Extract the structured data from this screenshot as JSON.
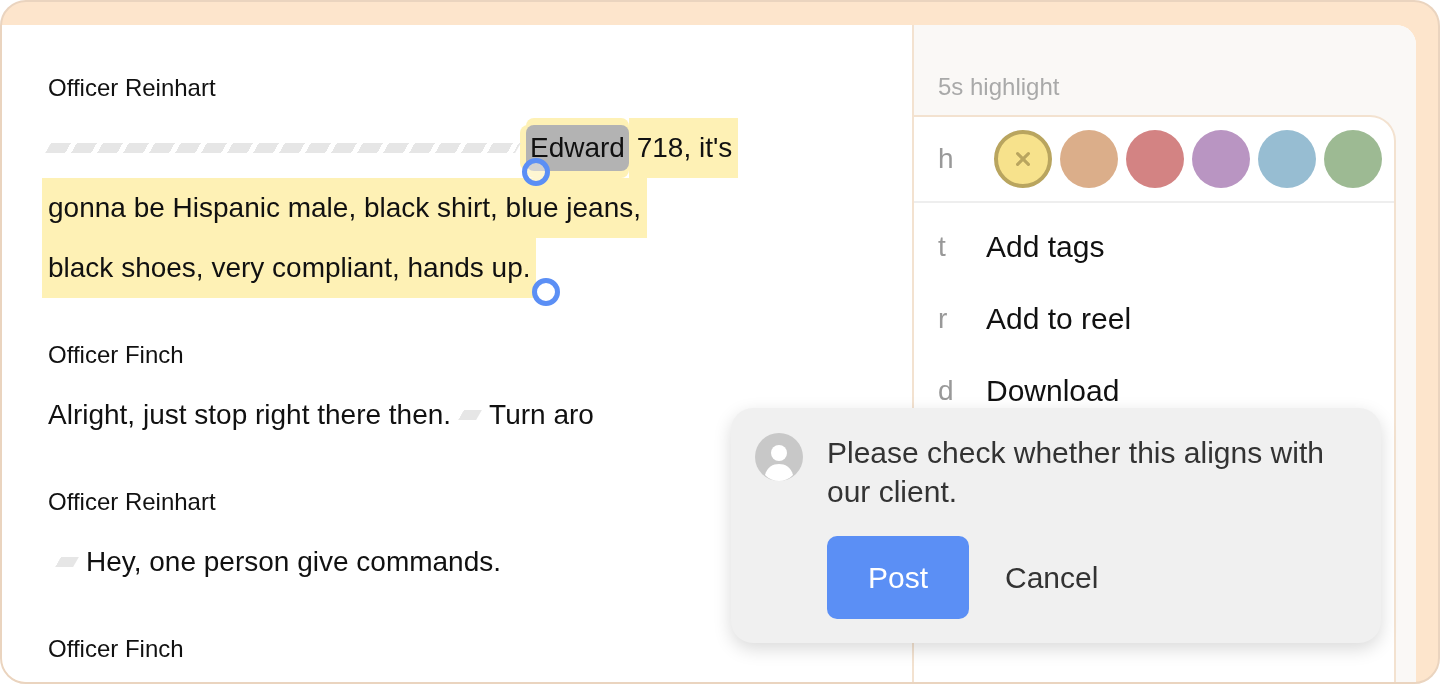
{
  "transcript": [
    {
      "speaker": "Officer Reinhart",
      "lines": [
        [
          {
            "kind": "longredaction"
          },
          {
            "kind": "handle"
          },
          {
            "kind": "text",
            "text": "Edward",
            "highlighted": true,
            "selected": true
          },
          {
            "kind": "text",
            "text": " 718, it's",
            "highlighted": true,
            "selected": false
          }
        ],
        [
          {
            "kind": "text",
            "text": "gonna be Hispanic male, black shirt, blue jeans,",
            "highlighted": true,
            "selected": false
          }
        ],
        [
          {
            "kind": "text",
            "text": "black shoes, very compliant, hands up.",
            "highlighted": true,
            "selected": false
          },
          {
            "kind": "handle"
          }
        ]
      ]
    },
    {
      "speaker": "Officer Finch",
      "lines": [
        [
          {
            "kind": "text",
            "text": "Alright, just stop right there then.",
            "highlighted": false,
            "selected": false
          },
          {
            "kind": "redaction"
          },
          {
            "kind": "text",
            "text": "Turn aro",
            "highlighted": false,
            "selected": false
          }
        ]
      ]
    },
    {
      "speaker": "Officer Reinhart",
      "lines": [
        [
          {
            "kind": "redaction"
          },
          {
            "kind": "text",
            "text": "Hey, one person give commands.",
            "highlighted": false,
            "selected": false
          }
        ]
      ]
    },
    {
      "speaker": "Officer Finch"
    }
  ],
  "panel": {
    "label": "5s highlight",
    "color_row": {
      "key": "h",
      "colors": [
        {
          "color": "#f7e28c",
          "selected": true
        },
        {
          "color": "#dbae8a",
          "selected": false
        },
        {
          "color": "#d38383",
          "selected": false
        },
        {
          "color": "#b995c2",
          "selected": false
        },
        {
          "color": "#97bdd2",
          "selected": false
        },
        {
          "color": "#9dba93",
          "selected": false
        }
      ]
    },
    "items": [
      {
        "key": "t",
        "label": "Add tags"
      },
      {
        "key": "r",
        "label": "Add to reel"
      },
      {
        "key": "d",
        "label": "Download"
      }
    ]
  },
  "comment": {
    "text": "Please check whether this aligns with our client.",
    "post": "Post",
    "cancel": "Cancel"
  }
}
